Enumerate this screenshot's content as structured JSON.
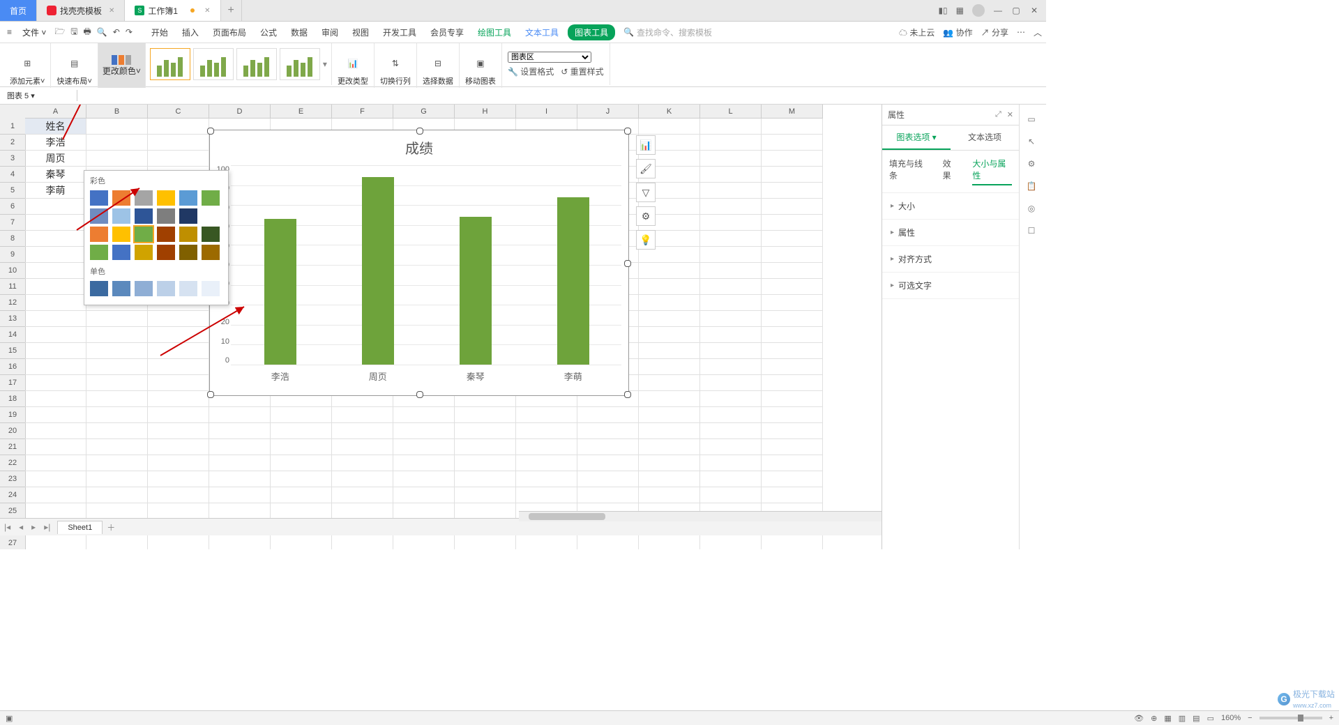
{
  "titlebar": {
    "tabs": [
      {
        "label": "首页",
        "active": true
      },
      {
        "label": "找壳壳模板",
        "icon": "#e23"
      },
      {
        "label": "工作簿1",
        "icon": "#07a35a",
        "unsaved": true
      }
    ],
    "new_tab": "+",
    "win": {
      "min": "—",
      "max": "▢",
      "close": "✕"
    }
  },
  "menubar": {
    "file": "文件",
    "tabs": [
      "开始",
      "插入",
      "页面布局",
      "公式",
      "数据",
      "审阅",
      "视图",
      "开发工具",
      "会员专享"
    ],
    "ctx": [
      "绘图工具",
      "文本工具"
    ],
    "chart_tab": "图表工具",
    "search_ph": "查找命令、搜索模板",
    "cloud": "未上云",
    "coop": "协作",
    "share": "分享"
  },
  "ribbon": {
    "add_el": "添加元素",
    "quick": "快速布局",
    "color": "更改颜色",
    "type": "更改类型",
    "switch": "切换行列",
    "seldata": "选择数据",
    "move": "移动图表",
    "area_sel": "图表区",
    "setfmt": "设置格式",
    "reset": "重置样式"
  },
  "namebox": "图表 5",
  "color_popup": {
    "sec1": "彩色",
    "row1": [
      "#4472c4",
      "#ed7d31",
      "#a5a5a5",
      "#ffc000",
      "#5b9bd5",
      "#70ad47"
    ],
    "row2": [
      "#6f8cc0",
      "#9dc3e6",
      "#2e5597",
      "#7e7e7e",
      "#203864"
    ],
    "row3": [
      "#ed7d31",
      "#ffc000",
      "#70ad47",
      "#a04000",
      "#bf8f00",
      "#385723"
    ],
    "row4": [
      "#70ad47",
      "#4472c4",
      "#d0a300",
      "#a04000",
      "#806000",
      "#9c6a00"
    ],
    "sec2": "单色",
    "mono": [
      "#3b6aa0",
      "#5b89bd",
      "#8faed5",
      "#bcd0e8",
      "#d6e2f1",
      "#e9f0f9"
    ]
  },
  "sheet": {
    "cols": [
      "A",
      "B",
      "C",
      "D",
      "E",
      "F",
      "G",
      "H",
      "I",
      "J",
      "K",
      "L",
      "M"
    ],
    "rows": 27,
    "a_col": [
      "姓名",
      "李浩",
      "周页",
      "秦琴",
      "李萌"
    ]
  },
  "chart_data": {
    "type": "bar",
    "title": "成绩",
    "categories": [
      "李浩",
      "周页",
      "秦琴",
      "李萌"
    ],
    "values": [
      73,
      94,
      74,
      84
    ],
    "ylim": [
      0,
      100
    ],
    "yticks": [
      0,
      10,
      20,
      30,
      40,
      50,
      60,
      70,
      80,
      90,
      100
    ],
    "color": "#6ea33b"
  },
  "chart_side_icons": [
    "bar-edit-icon",
    "brush-icon",
    "filter-icon",
    "gear-icon",
    "bulb-icon"
  ],
  "prop": {
    "title": "属性",
    "tab1": "图表选项",
    "tab2": "文本选项",
    "sub": [
      "填充与线条",
      "效果",
      "大小与属性"
    ],
    "active_sub": "大小与属性",
    "secs": [
      "大小",
      "属性",
      "对齐方式",
      "可选文字"
    ]
  },
  "sheet_tab": "Sheet1",
  "status": {
    "zoom": "160%",
    "views": [
      "normal",
      "page",
      "pagebreak",
      "reading"
    ]
  },
  "watermark": {
    "text": "极光下载站",
    "url": "www.xz7.com"
  }
}
